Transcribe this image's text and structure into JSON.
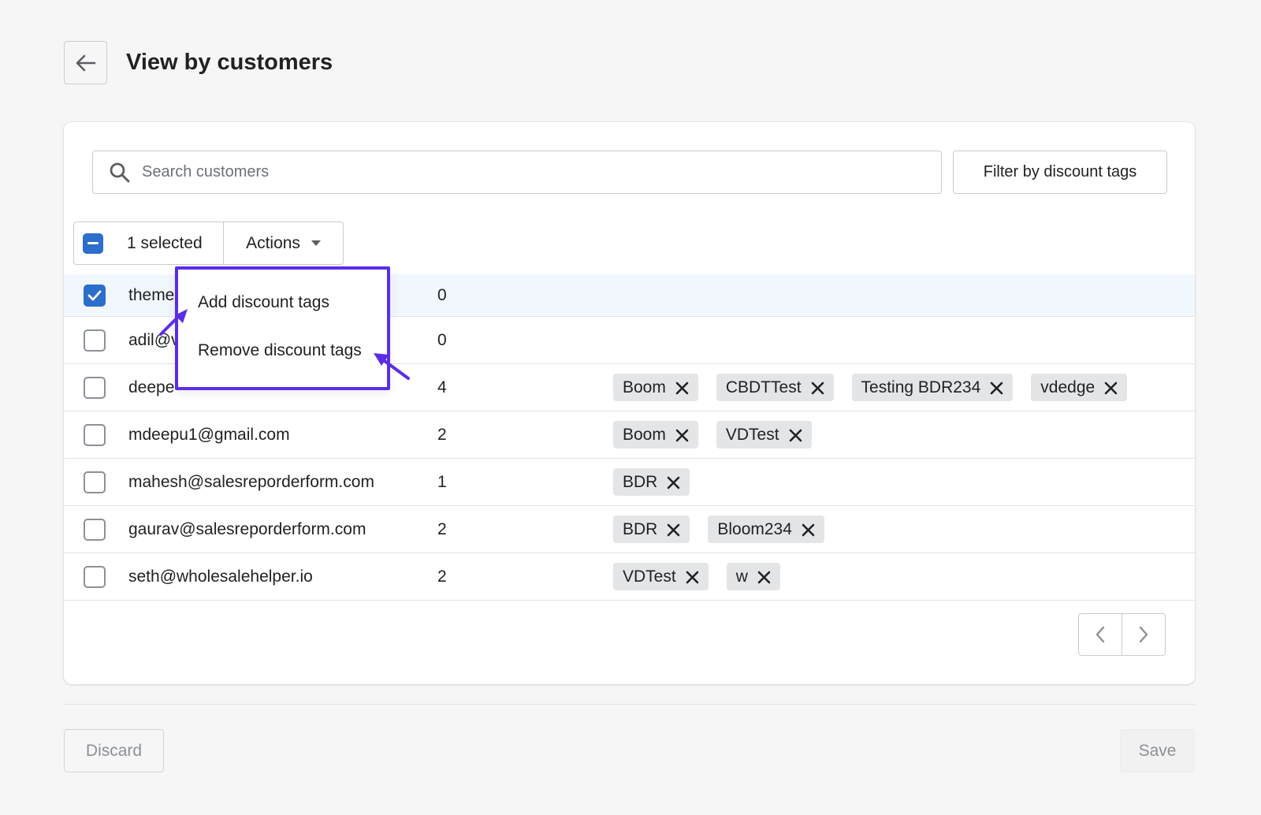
{
  "header": {
    "title": "View by customers",
    "back_icon": "arrow-left-icon"
  },
  "search": {
    "placeholder": "Search customers",
    "icon": "search-icon"
  },
  "filter_button": {
    "label": "Filter by discount tags"
  },
  "bulk_actions": {
    "selected_label": "1 selected",
    "actions_label": "Actions"
  },
  "actions_menu": {
    "items": [
      "Add discount tags",
      "Remove discount tags"
    ],
    "highlight_color": "#5b2ee6"
  },
  "customers": [
    {
      "email": "theme",
      "count": "0",
      "checked": true,
      "tags": []
    },
    {
      "email": "adil@v",
      "count": "0",
      "checked": false,
      "tags": []
    },
    {
      "email": "deepe",
      "count": "4",
      "checked": false,
      "tags": [
        "Boom",
        "CBDTTest",
        "Testing BDR234",
        "vdedge"
      ]
    },
    {
      "email": "mdeepu1@gmail.com",
      "count": "2",
      "checked": false,
      "tags": [
        "Boom",
        "VDTest"
      ]
    },
    {
      "email": "mahesh@salesreporderform.com",
      "count": "1",
      "checked": false,
      "tags": [
        "BDR"
      ]
    },
    {
      "email": "gaurav@salesreporderform.com",
      "count": "2",
      "checked": false,
      "tags": [
        "BDR",
        "Bloom234"
      ]
    },
    {
      "email": "seth@wholesalehelper.io",
      "count": "2",
      "checked": false,
      "tags": [
        "VDTest",
        "w"
      ]
    }
  ],
  "footer": {
    "discard_label": "Discard",
    "save_label": "Save"
  },
  "colors": {
    "accent": "#2c6ecb",
    "selected_row": "#f2f7fe",
    "tag_bg": "#e4e5e7"
  }
}
